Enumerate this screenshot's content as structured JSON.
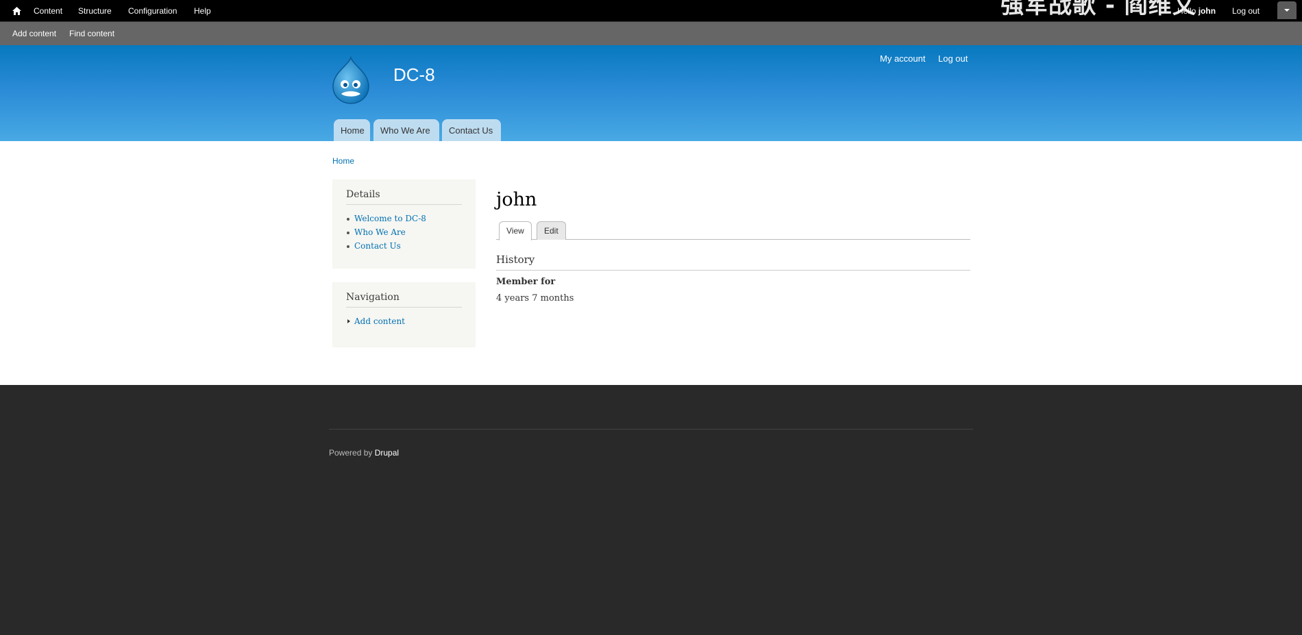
{
  "toolbar": {
    "items": [
      "Content",
      "Structure",
      "Configuration",
      "Help"
    ],
    "watermark": "强军战歌 - 阎维文",
    "hello_prefix": "Hello",
    "user": "john",
    "logout": "Log out"
  },
  "shortcuts": [
    "Add content",
    "Find content"
  ],
  "header": {
    "site_name": "DC-8",
    "secondary_links": [
      "My account",
      "Log out"
    ],
    "main_menu": [
      "Home",
      "Who We Are",
      "Contact Us"
    ]
  },
  "breadcrumb": "Home",
  "sidebar": {
    "details": {
      "title": "Details",
      "items": [
        "Welcome to DC-8",
        "Who We Are",
        "Contact Us"
      ]
    },
    "navigation": {
      "title": "Navigation",
      "items": [
        "Add content"
      ]
    }
  },
  "main": {
    "title": "john",
    "tabs": [
      "View",
      "Edit"
    ],
    "history_title": "History",
    "member_label": "Member for",
    "member_value": "4 years 7 months"
  },
  "footer": {
    "powered_prefix": "Powered by",
    "powered_link": "Drupal"
  }
}
